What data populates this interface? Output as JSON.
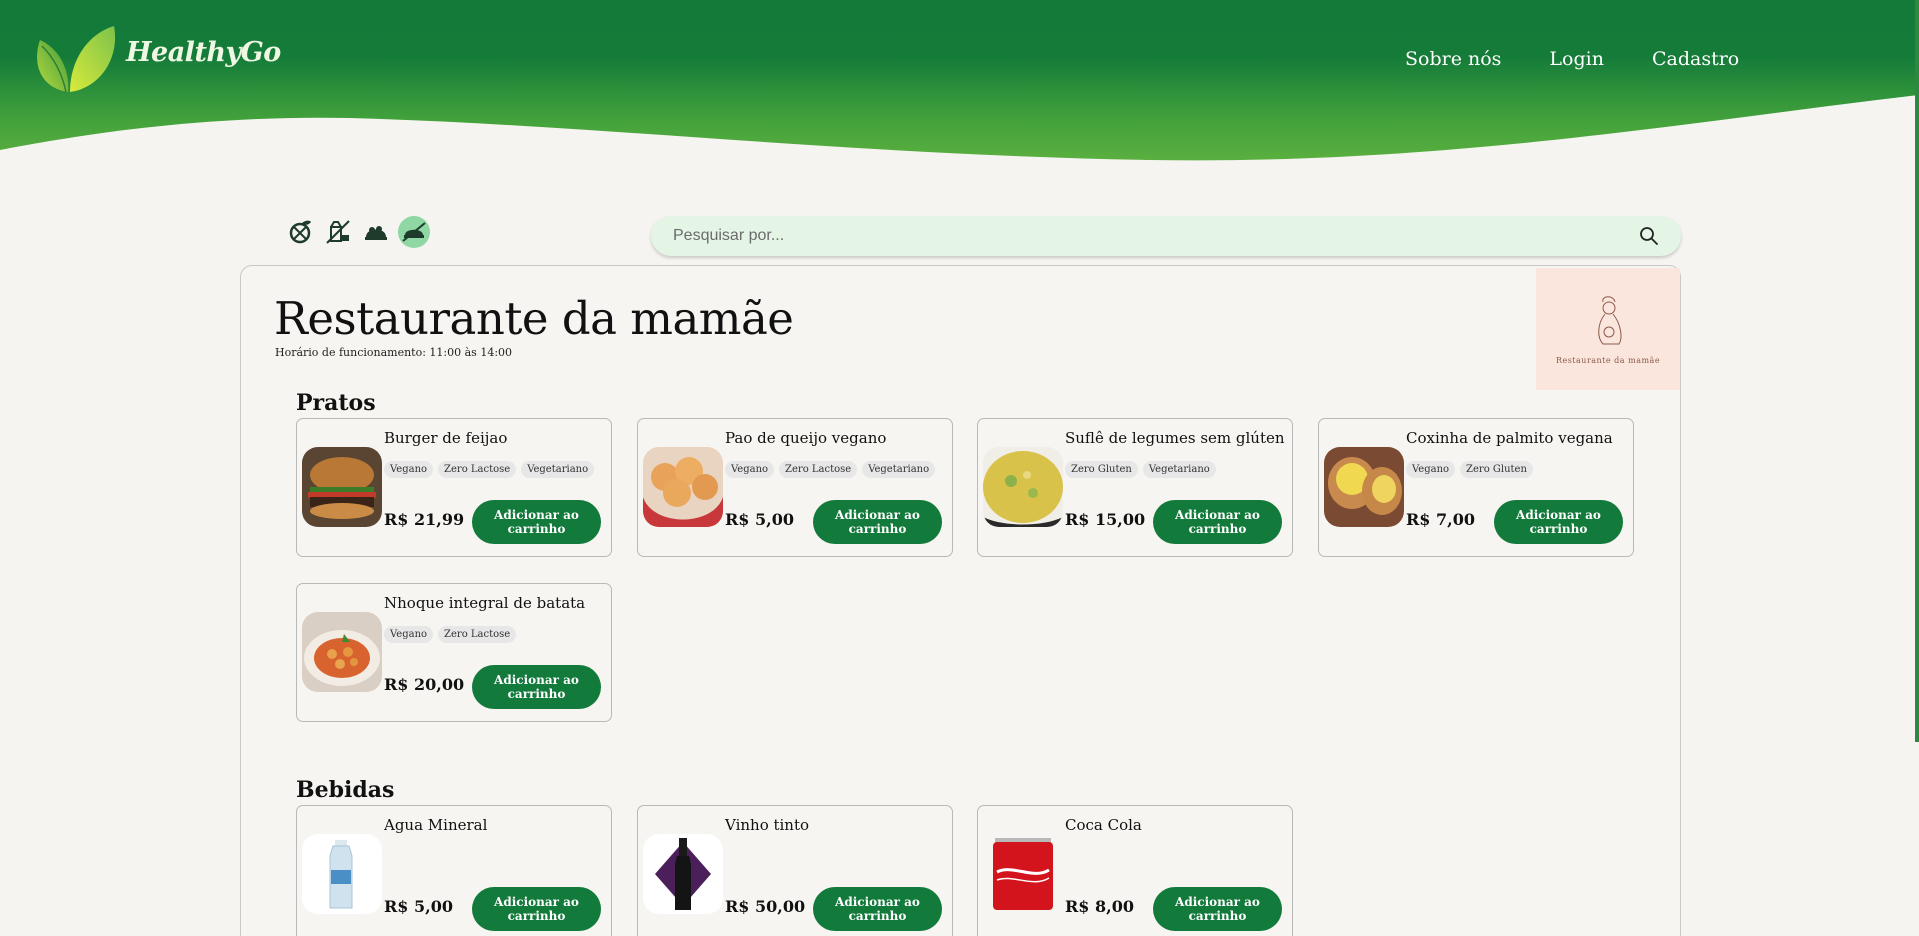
{
  "header": {
    "brand": "HealthyGo",
    "nav": [
      {
        "label": "Sobre nós"
      },
      {
        "label": "Login"
      },
      {
        "label": "Cadastro"
      }
    ]
  },
  "filters": [
    {
      "icon": "leaf-filter-icon"
    },
    {
      "icon": "milk-free-filter-icon"
    },
    {
      "icon": "vegetarian-filter-icon"
    },
    {
      "icon": "gluten-free-filter-icon"
    }
  ],
  "search": {
    "placeholder": "Pesquisar por..."
  },
  "restaurant": {
    "name": "Restaurante da mamãe",
    "hours": "Horário de funcionamento: 11:00 às 14:00",
    "logo_text": "Restaurante da mamãe"
  },
  "sections": [
    {
      "title": "Pratos",
      "items": [
        {
          "name": "Burger de feijao",
          "tags": [
            "Vegano",
            "Zero Lactose",
            "Vegetariano"
          ],
          "price": "R$ 21,99",
          "button": "Adicionar ao carrinho"
        },
        {
          "name": "Pao de queijo vegano",
          "tags": [
            "Vegano",
            "Zero Lactose",
            "Vegetariano"
          ],
          "price": "R$ 5,00",
          "button": "Adicionar ao carrinho"
        },
        {
          "name": "Suflê de legumes sem glúten",
          "tags": [
            "Zero Gluten",
            "Vegetariano"
          ],
          "price": "R$ 15,00",
          "button": "Adicionar ao carrinho"
        },
        {
          "name": "Coxinha de palmito vegana",
          "tags": [
            "Vegano",
            "Zero Gluten"
          ],
          "price": "R$ 7,00",
          "button": "Adicionar ao carrinho"
        },
        {
          "name": "Nhoque integral de batata",
          "tags": [
            "Vegano",
            "Zero Lactose"
          ],
          "price": "R$ 20,00",
          "button": "Adicionar ao carrinho"
        }
      ]
    },
    {
      "title": "Bebidas",
      "items": [
        {
          "name": "Agua Mineral",
          "tags": [],
          "price": "R$ 5,00",
          "button": "Adicionar ao carrinho"
        },
        {
          "name": "Vinho tinto",
          "tags": [],
          "price": "R$ 50,00",
          "button": "Adicionar ao carrinho"
        },
        {
          "name": "Coca Cola",
          "tags": [],
          "price": "R$ 8,00",
          "button": "Adicionar ao carrinho"
        }
      ]
    }
  ],
  "colors": {
    "header_green": "#147a3a",
    "header_light": "#4fa63e",
    "button_green": "#127a3b",
    "search_bg": "#e4f5e6"
  }
}
